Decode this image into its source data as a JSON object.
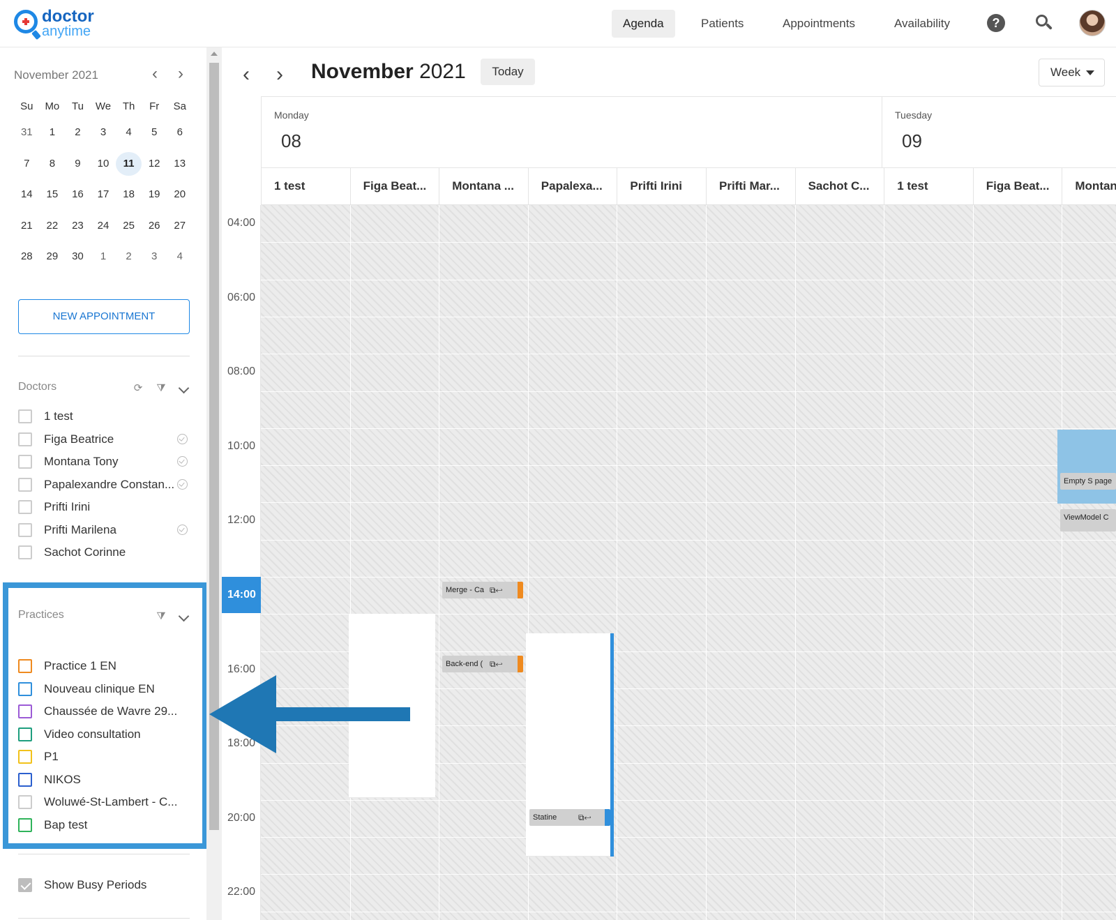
{
  "app": {
    "logo_line1": "doctor",
    "logo_line2": "anytime"
  },
  "nav": {
    "agenda": "Agenda",
    "patients": "Patients",
    "appointments": "Appointments",
    "availability": "Availability",
    "help_icon": "help-icon",
    "search_icon": "search-icon"
  },
  "mini_calendar": {
    "month": "November 2021",
    "dow": [
      "Su",
      "Mo",
      "Tu",
      "We",
      "Th",
      "Fr",
      "Sa"
    ],
    "weeks": [
      [
        "31",
        "1",
        "2",
        "3",
        "4",
        "5",
        "6"
      ],
      [
        "7",
        "8",
        "9",
        "10",
        "11",
        "12",
        "13"
      ],
      [
        "14",
        "15",
        "16",
        "17",
        "18",
        "19",
        "20"
      ],
      [
        "21",
        "22",
        "23",
        "24",
        "25",
        "26",
        "27"
      ],
      [
        "28",
        "29",
        "30",
        "1",
        "2",
        "3",
        "4"
      ]
    ],
    "today": "11"
  },
  "sidebar": {
    "new_appointment": "NEW APPOINTMENT",
    "doctors_title": "Doctors",
    "doctors": [
      {
        "name": "1 test",
        "sync": false
      },
      {
        "name": "Figa Beatrice",
        "sync": true
      },
      {
        "name": "Montana Tony",
        "sync": true
      },
      {
        "name": "Papalexandre Constan...",
        "sync": true
      },
      {
        "name": "Prifti Irini",
        "sync": false
      },
      {
        "name": "Prifti Marilena",
        "sync": true
      },
      {
        "name": "Sachot Corinne",
        "sync": false
      }
    ],
    "practices_title": "Practices",
    "practices": [
      {
        "name": "Practice 1 EN",
        "color": "#ef8a1f"
      },
      {
        "name": "Nouveau clinique EN",
        "color": "#2f8fdc"
      },
      {
        "name": "Chaussée de Wavre 29...",
        "color": "#9c5bd6"
      },
      {
        "name": "Video consultation",
        "color": "#1e9e7e"
      },
      {
        "name": "P1",
        "color": "#f2c21b"
      },
      {
        "name": "NIKOS",
        "color": "#2b5fce"
      },
      {
        "name": "Woluwé-St-Lambert - C...",
        "color": "#cccccc"
      },
      {
        "name": "Bap test",
        "color": "#2fb35a"
      }
    ],
    "show_busy": "Show Busy Periods"
  },
  "calendar": {
    "title_month": "November",
    "title_year": "2021",
    "today_label": "Today",
    "view_label": "Week",
    "days": [
      {
        "name": "Monday",
        "num": "08"
      },
      {
        "name": "Tuesday",
        "num": "09"
      }
    ],
    "resources": [
      "1 test",
      "Figa Beat...",
      "Montana ...",
      "Papalexa...",
      "Prifti Irini",
      "Prifti Mar...",
      "Sachot C...",
      "1 test",
      "Figa Beat...",
      "Montana"
    ],
    "times": [
      "04:00",
      "06:00",
      "08:00",
      "10:00",
      "12:00",
      "14:00",
      "16:00",
      "18:00",
      "20:00",
      "22:00"
    ],
    "active_time": "14:00",
    "events": {
      "merge": "Merge - Ca",
      "backend": "Back-end (",
      "statine": "Statine",
      "empty": "Empty S page",
      "viewmodel": "ViewModel C"
    }
  }
}
